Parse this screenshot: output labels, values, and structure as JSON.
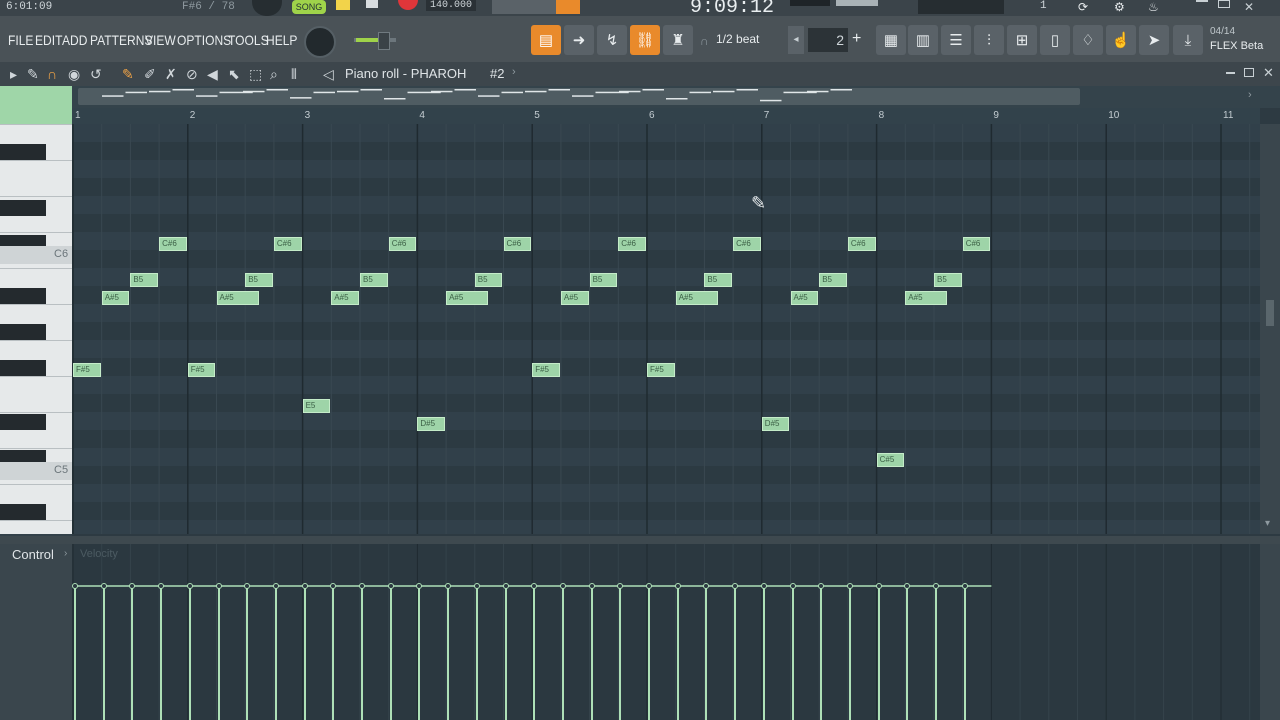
{
  "topstrip": {
    "song_time": "6:01:09",
    "note_hint": "F#6 / 78",
    "song_mode_label": "SONG",
    "tempo": "140.000",
    "clock": "9:09:12",
    "counter": "1"
  },
  "menu": {
    "items": [
      "FILE",
      "EDIT",
      "ADD",
      "PATTERNS",
      "VIEW",
      "OPTIONS",
      "TOOLS",
      "HELP"
    ]
  },
  "toolbar": {
    "snap_label": "1/2 beat",
    "pattern_number": "2",
    "version_date": "04/14",
    "version_name": "FLEX Beta"
  },
  "pianoroll": {
    "title": "Piano roll - PHAROH",
    "pattern_label": "#2",
    "bar_numbers": [
      "1",
      "2",
      "3",
      "4",
      "5",
      "6",
      "7",
      "8",
      "9",
      "10",
      "11"
    ],
    "key_labels": {
      "c6": "C6",
      "c5": "C5"
    },
    "notes": [
      {
        "label": "F#5",
        "bar": 1.0,
        "len": 0.25,
        "pitch": "F#5"
      },
      {
        "label": "A#5",
        "bar": 1.25,
        "len": 0.25,
        "pitch": "A#5"
      },
      {
        "label": "B5",
        "bar": 1.5,
        "len": 0.25,
        "pitch": "B5"
      },
      {
        "label": "C#6",
        "bar": 1.75,
        "len": 0.25,
        "pitch": "C#6"
      },
      {
        "label": "F#5",
        "bar": 2.0,
        "len": 0.25,
        "pitch": "F#5"
      },
      {
        "label": "A#5",
        "bar": 2.25,
        "len": 0.375,
        "pitch": "A#5"
      },
      {
        "label": "B5",
        "bar": 2.5,
        "len": 0.25,
        "pitch": "B5"
      },
      {
        "label": "C#6",
        "bar": 2.75,
        "len": 0.25,
        "pitch": "C#6"
      },
      {
        "label": "E5",
        "bar": 3.0,
        "len": 0.25,
        "pitch": "E5"
      },
      {
        "label": "A#5",
        "bar": 3.25,
        "len": 0.25,
        "pitch": "A#5"
      },
      {
        "label": "B5",
        "bar": 3.5,
        "len": 0.25,
        "pitch": "B5"
      },
      {
        "label": "C#6",
        "bar": 3.75,
        "len": 0.25,
        "pitch": "C#6"
      },
      {
        "label": "D#5",
        "bar": 4.0,
        "len": 0.25,
        "pitch": "D#5"
      },
      {
        "label": "A#5",
        "bar": 4.25,
        "len": 0.375,
        "pitch": "A#5"
      },
      {
        "label": "B5",
        "bar": 4.5,
        "len": 0.25,
        "pitch": "B5"
      },
      {
        "label": "C#6",
        "bar": 4.75,
        "len": 0.25,
        "pitch": "C#6"
      },
      {
        "label": "F#5",
        "bar": 5.0,
        "len": 0.25,
        "pitch": "F#5"
      },
      {
        "label": "A#5",
        "bar": 5.25,
        "len": 0.25,
        "pitch": "A#5"
      },
      {
        "label": "B5",
        "bar": 5.5,
        "len": 0.25,
        "pitch": "B5"
      },
      {
        "label": "C#6",
        "bar": 5.75,
        "len": 0.25,
        "pitch": "C#6"
      },
      {
        "label": "F#5",
        "bar": 6.0,
        "len": 0.25,
        "pitch": "F#5"
      },
      {
        "label": "A#5",
        "bar": 6.25,
        "len": 0.375,
        "pitch": "A#5"
      },
      {
        "label": "B5",
        "bar": 6.5,
        "len": 0.25,
        "pitch": "B5"
      },
      {
        "label": "C#6",
        "bar": 6.75,
        "len": 0.25,
        "pitch": "C#6"
      },
      {
        "label": "D#5",
        "bar": 7.0,
        "len": 0.25,
        "pitch": "D#5"
      },
      {
        "label": "A#5",
        "bar": 7.25,
        "len": 0.25,
        "pitch": "A#5"
      },
      {
        "label": "B5",
        "bar": 7.5,
        "len": 0.25,
        "pitch": "B5"
      },
      {
        "label": "C#6",
        "bar": 7.75,
        "len": 0.25,
        "pitch": "C#6"
      },
      {
        "label": "C#5",
        "bar": 8.0,
        "len": 0.25,
        "pitch": "C#5"
      },
      {
        "label": "A#5",
        "bar": 8.25,
        "len": 0.375,
        "pitch": "A#5"
      },
      {
        "label": "B5",
        "bar": 8.5,
        "len": 0.25,
        "pitch": "B5"
      },
      {
        "label": "C#6",
        "bar": 8.75,
        "len": 0.25,
        "pitch": "C#6"
      }
    ]
  },
  "control": {
    "label": "Control",
    "target": "Velocity"
  },
  "colors": {
    "note_fill": "#9ed4a8",
    "grid_bg": "#2f3e46",
    "accent_orange": "#e98a2b"
  }
}
